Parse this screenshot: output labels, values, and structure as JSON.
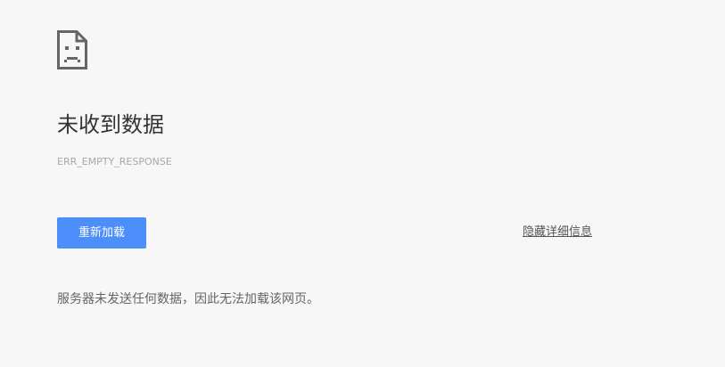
{
  "icons": {
    "error": "sad-page-icon"
  },
  "colors": {
    "accent": "#4c8efa",
    "title": "#333333",
    "error_code": "#a8a8a8",
    "text": "#646464",
    "background": "#f7f7f7"
  },
  "main": {
    "title": "未收到数据",
    "error_code": "ERR_EMPTY_RESPONSE",
    "reload_label": "重新加载",
    "details_label": "隐藏详细信息",
    "description": "服务器未发送任何数据，因此无法加载该网页。"
  }
}
